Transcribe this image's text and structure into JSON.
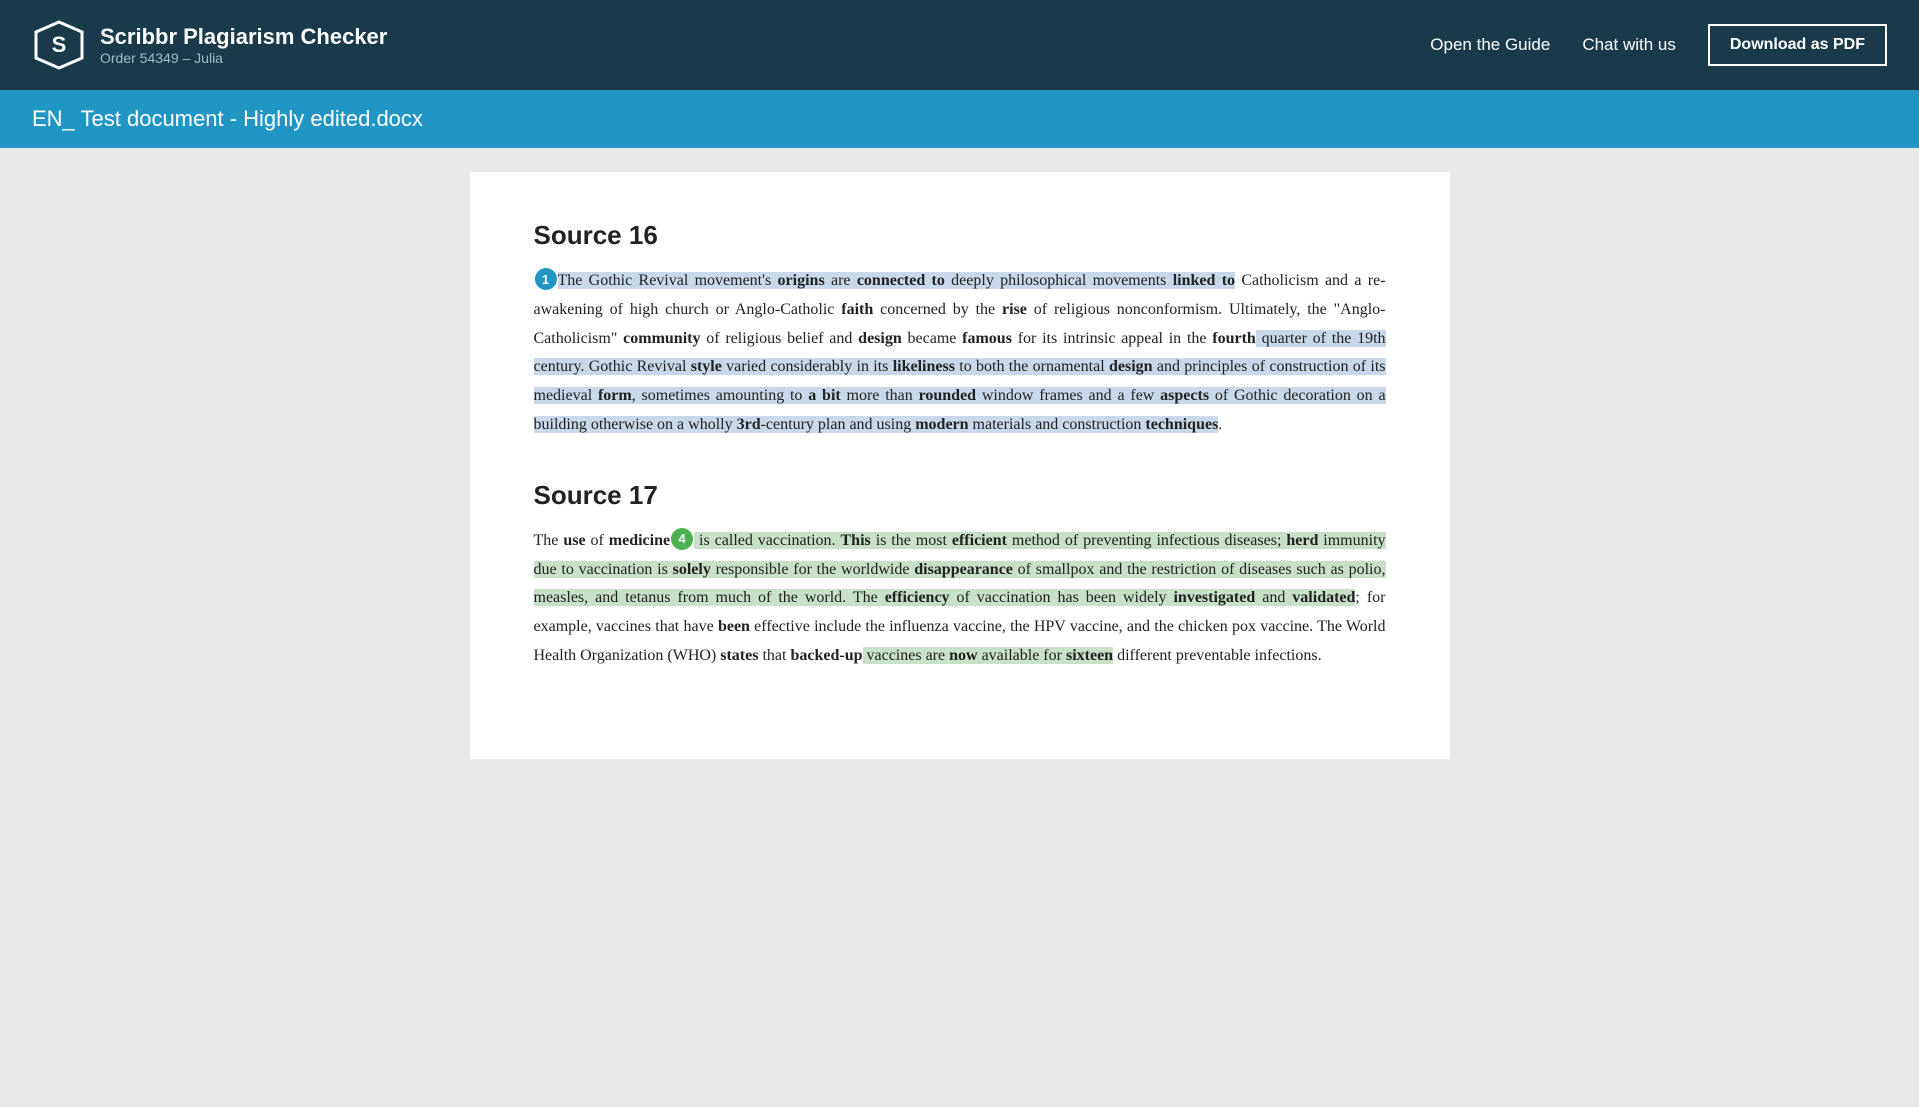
{
  "header": {
    "logo_title": "Scribbr Plagiarism Checker",
    "logo_subtitle": "Order 54349 – Julia",
    "nav": {
      "guide": "Open the Guide",
      "chat": "Chat with us",
      "download": "Download as PDF"
    }
  },
  "doc_title": "EN_ Test document - Highly edited.docx",
  "sources": [
    {
      "id": "source16",
      "heading": "Source 16",
      "badge_num": "1",
      "badge_color": "blue",
      "badge_position": "start",
      "text_segments": [
        {
          "t": "The Gothic Revival movement's ",
          "style": "hl-blue"
        },
        {
          "t": "origins",
          "style": "hl-blue bw"
        },
        {
          "t": " are ",
          "style": "hl-blue"
        },
        {
          "t": "connected to",
          "style": "hl-blue bw"
        },
        {
          "t": " deeply philosophical movements ",
          "style": "hl-blue"
        },
        {
          "t": "linked to",
          "style": "hl-blue bw"
        },
        {
          "t": " Catholicism and a re-awakening of high church or Anglo-Catholic ",
          "style": ""
        },
        {
          "t": "faith",
          "style": "bw"
        },
        {
          "t": " concerned by the ",
          "style": ""
        },
        {
          "t": "rise",
          "style": "bw"
        },
        {
          "t": " of religious nonconformism. Ultimately, the \"Anglo-Catholicism\" ",
          "style": ""
        },
        {
          "t": "community",
          "style": "bw"
        },
        {
          "t": " of religious belief and ",
          "style": ""
        },
        {
          "t": "design",
          "style": "bw"
        },
        {
          "t": " became ",
          "style": ""
        },
        {
          "t": "famous",
          "style": "bw"
        },
        {
          "t": " for its intrinsic appeal in the ",
          "style": ""
        },
        {
          "t": "fourth",
          "style": "bw"
        },
        {
          "t": " quarter of the 19th century. Gothic Revival ",
          "style": "hl-blue"
        },
        {
          "t": "style",
          "style": "hl-blue bw"
        },
        {
          "t": " varied considerably in its ",
          "style": "hl-blue"
        },
        {
          "t": "likeliness",
          "style": "hl-blue bw"
        },
        {
          "t": " to both the ornamental ",
          "style": "hl-blue"
        },
        {
          "t": "design",
          "style": "hl-blue bw"
        },
        {
          "t": " and principles of construction of its medieval ",
          "style": "hl-blue"
        },
        {
          "t": "form",
          "style": "hl-blue bw"
        },
        {
          "t": ", sometimes amounting to ",
          "style": "hl-blue"
        },
        {
          "t": "a bit",
          "style": "hl-blue bw"
        },
        {
          "t": " more than ",
          "style": "hl-blue"
        },
        {
          "t": "rounded",
          "style": "hl-blue bw"
        },
        {
          "t": " window frames and a few ",
          "style": "hl-blue"
        },
        {
          "t": "aspects",
          "style": "hl-blue bw"
        },
        {
          "t": " of Gothic decoration on a building otherwise on a wholly ",
          "style": "hl-blue"
        },
        {
          "t": "3rd",
          "style": "hl-blue bw"
        },
        {
          "t": "-century plan and using ",
          "style": "hl-blue"
        },
        {
          "t": "modern",
          "style": "hl-blue bw"
        },
        {
          "t": " materials and construction ",
          "style": "hl-blue"
        },
        {
          "t": "techniques",
          "style": "hl-blue bw"
        },
        {
          "t": ".",
          "style": ""
        }
      ]
    },
    {
      "id": "source17",
      "heading": "Source 17",
      "badge_num": "4",
      "badge_color": "green",
      "badge_position": "after_medicine",
      "text_segments": [
        {
          "t": "The ",
          "style": ""
        },
        {
          "t": "use",
          "style": "bw"
        },
        {
          "t": " of ",
          "style": ""
        },
        {
          "t": "medicine",
          "style": "bw"
        },
        {
          "t": " is called vaccination. ",
          "style": "hl-green"
        },
        {
          "t": "This",
          "style": "hl-green bw"
        },
        {
          "t": " is the most ",
          "style": "hl-green"
        },
        {
          "t": "efficient",
          "style": "hl-green bw"
        },
        {
          "t": " method of preventing infectious diseases; ",
          "style": "hl-green"
        },
        {
          "t": "herd",
          "style": "hl-green bw"
        },
        {
          "t": " immunity due to vaccination is ",
          "style": "hl-green"
        },
        {
          "t": "solely",
          "style": "hl-green bw"
        },
        {
          "t": " responsible for the worldwide ",
          "style": "hl-green"
        },
        {
          "t": "disappearance",
          "style": "hl-green bw"
        },
        {
          "t": " of smallpox and the restriction of diseases such as polio, measles, and tetanus from much of the world. The ",
          "style": "hl-green"
        },
        {
          "t": "efficiency",
          "style": "hl-green bw"
        },
        {
          "t": " of vaccination has been widely ",
          "style": "hl-green"
        },
        {
          "t": "investigated",
          "style": "hl-green bw"
        },
        {
          "t": " and ",
          "style": "hl-green"
        },
        {
          "t": "validated",
          "style": "hl-green bw"
        },
        {
          "t": "; for example, vaccines that have ",
          "style": ""
        },
        {
          "t": "been",
          "style": "bw"
        },
        {
          "t": " effective include the influenza vaccine, the HPV vaccine, and the chicken pox vaccine. The World Health Organization (WHO) ",
          "style": ""
        },
        {
          "t": "states",
          "style": "bw"
        },
        {
          "t": " that ",
          "style": ""
        },
        {
          "t": "backed-up",
          "style": "bw"
        },
        {
          "t": " vaccines are ",
          "style": "hl-green"
        },
        {
          "t": "now",
          "style": "hl-green bw"
        },
        {
          "t": " available for ",
          "style": "hl-green"
        },
        {
          "t": "sixteen",
          "style": "hl-green bw"
        },
        {
          "t": " different preventable infections.",
          "style": ""
        }
      ]
    }
  ]
}
